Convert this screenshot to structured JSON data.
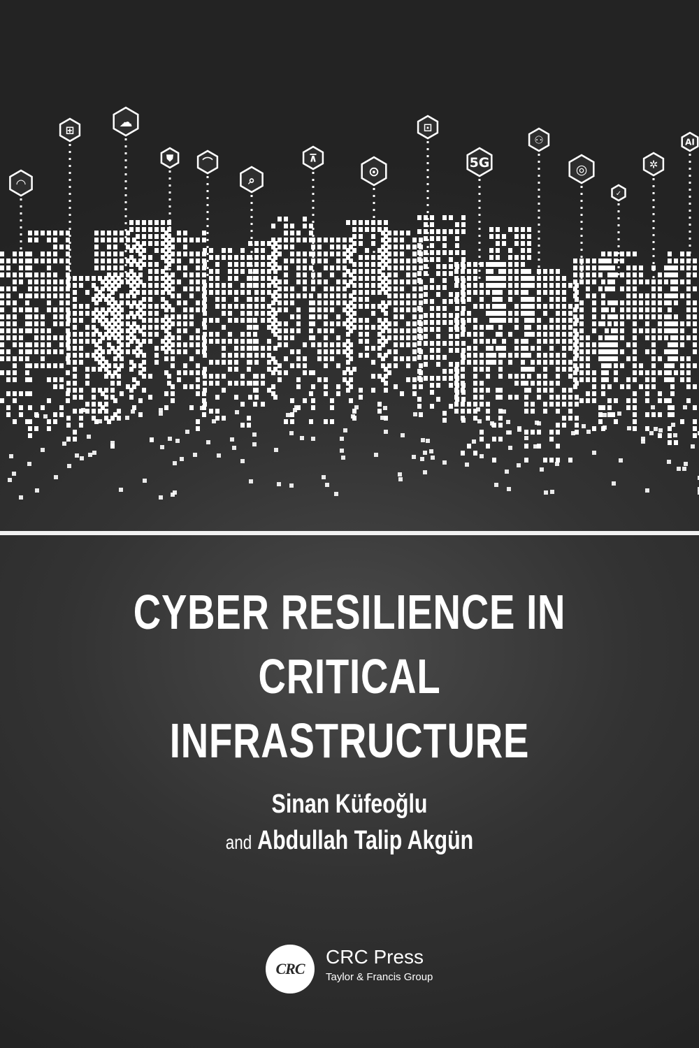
{
  "book": {
    "title_line1": "CYBER RESILIENCE IN",
    "title_line2": "CRITICAL INFRASTRUCTURE",
    "author1": "Sinan Küfeoğlu",
    "and_word": "and",
    "author2": "Abdullah Talip Akgün"
  },
  "publisher": {
    "logo_text": "CRC",
    "name": "CRC Press",
    "group": "Taylor & Francis Group"
  },
  "icon_badges": [
    {
      "name": "wifi-icon",
      "text": ""
    },
    {
      "name": "gift-icon",
      "text": ""
    },
    {
      "name": "cloud-icon",
      "text": ""
    },
    {
      "name": "shield-icon",
      "text": ""
    },
    {
      "name": "car-icon",
      "text": ""
    },
    {
      "name": "search-icon",
      "text": ""
    },
    {
      "name": "cart-icon",
      "text": ""
    },
    {
      "name": "location-pin-icon",
      "text": ""
    },
    {
      "name": "lock-icon",
      "text": ""
    },
    {
      "name": "5g-icon",
      "text": "5G"
    },
    {
      "name": "people-icon",
      "text": ""
    },
    {
      "name": "globe-icon",
      "text": ""
    },
    {
      "name": "like-icon",
      "text": ""
    },
    {
      "name": "gear-icon",
      "text": ""
    },
    {
      "name": "ai-icon",
      "text": "AI"
    }
  ],
  "colors": {
    "background": "#2d2d2d",
    "foreground": "#ffffff"
  }
}
